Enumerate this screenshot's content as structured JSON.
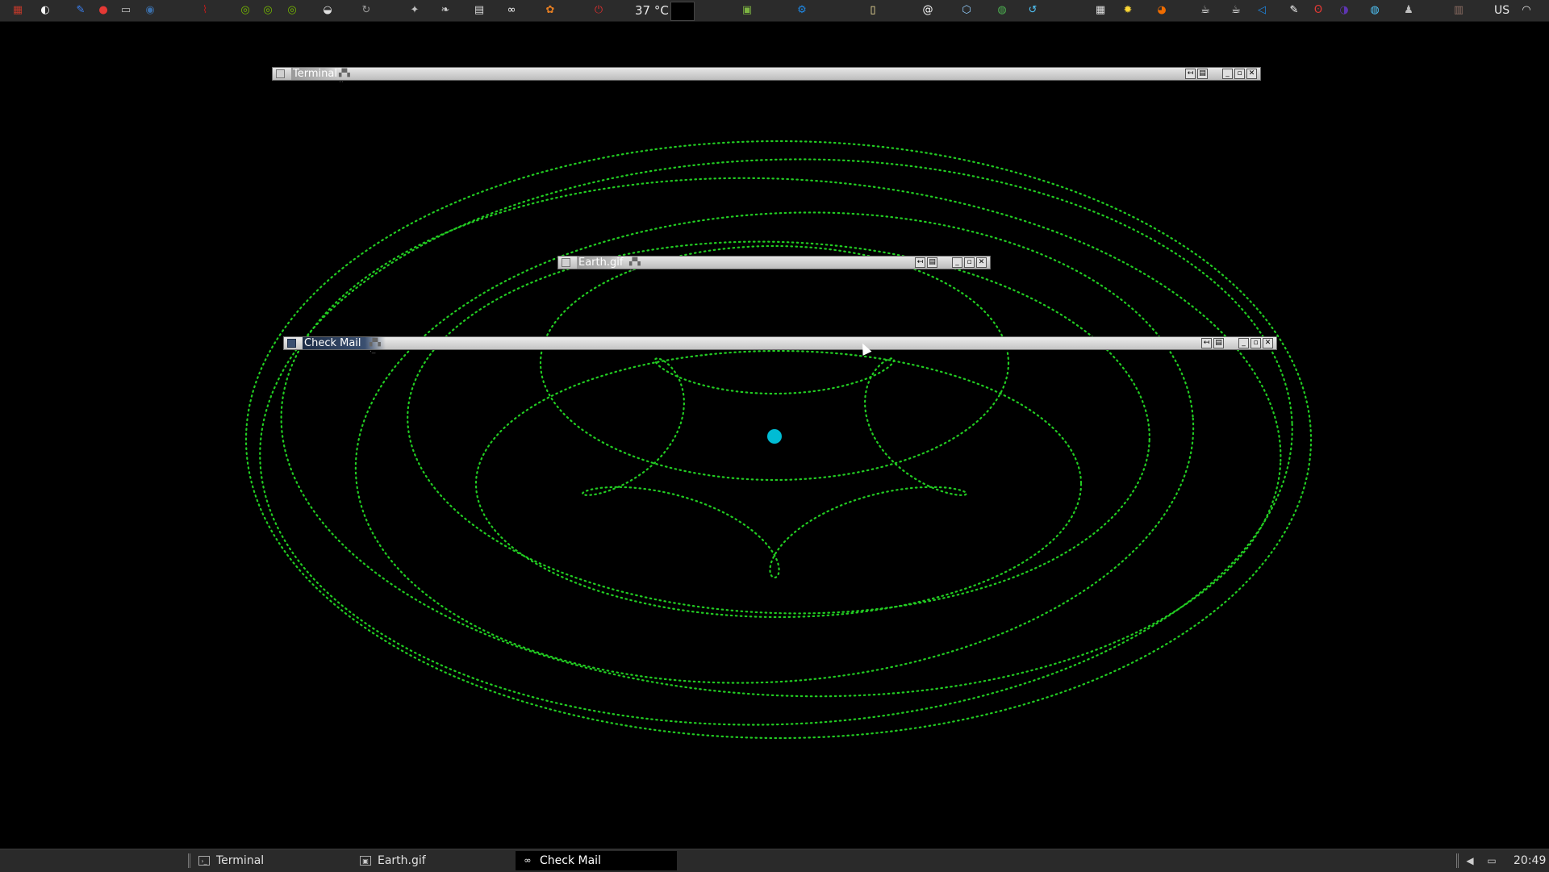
{
  "top_panel": {
    "temperature": "37 °C",
    "keyboard_layout": "US",
    "icons": [
      {
        "name": "app-grid-icon",
        "color": "#c0392b",
        "glyph": "▦"
      },
      {
        "name": "browser-icon",
        "color": "#f5f5f5",
        "glyph": "◐"
      },
      {
        "name": "notes-icon",
        "color": "#3b82f6",
        "glyph": "✎"
      },
      {
        "name": "apple-icon",
        "color": "#e53935",
        "glyph": "●"
      },
      {
        "name": "window-icon",
        "color": "#bdbdbd",
        "glyph": "▭"
      },
      {
        "name": "globe-icon",
        "color": "#3b6ea8",
        "glyph": "◉"
      },
      {
        "name": "chart-icon",
        "color": "#b71c1c",
        "glyph": "⌇"
      },
      {
        "name": "eye-icon-1",
        "color": "#76b900",
        "glyph": "◎"
      },
      {
        "name": "eye-icon-2",
        "color": "#76b900",
        "glyph": "◎"
      },
      {
        "name": "eye-icon-3",
        "color": "#76b900",
        "glyph": "◎"
      },
      {
        "name": "disk-icon",
        "color": "#e0e0e0",
        "glyph": "◒"
      },
      {
        "name": "reload-icon",
        "color": "#999999",
        "glyph": "↻"
      },
      {
        "name": "wrench-icon",
        "color": "#bfbfbf",
        "glyph": "✦"
      },
      {
        "name": "leaf-icon",
        "color": "#cccccc",
        "glyph": "❧"
      },
      {
        "name": "doc-icon",
        "color": "#d9d9d9",
        "glyph": "▤"
      },
      {
        "name": "glasses-icon",
        "color": "#ffffff",
        "glyph": "∞"
      },
      {
        "name": "flower-icon",
        "color": "#e67e22",
        "glyph": "✿"
      },
      {
        "name": "power-icon",
        "color": "#d32f2f",
        "glyph": "⏻"
      }
    ],
    "icons_right": [
      {
        "name": "screen-icon",
        "color": "#7cb342",
        "glyph": "▣"
      },
      {
        "name": "gear-icon",
        "color": "#1e88e5",
        "glyph": "⚙"
      },
      {
        "name": "note-icon",
        "color": "#f9e79f",
        "glyph": "▯"
      },
      {
        "name": "at-icon",
        "color": "#ffffff",
        "glyph": "@"
      },
      {
        "name": "cube-icon",
        "color": "#90caf9",
        "glyph": "⬡"
      },
      {
        "name": "chrome-icon",
        "color": "#4caf50",
        "glyph": "◍"
      },
      {
        "name": "sync-icon",
        "color": "#4fc3f7",
        "glyph": "↺"
      },
      {
        "name": "doc2-icon",
        "color": "#e0e0e0",
        "glyph": "▦"
      },
      {
        "name": "sun-icon",
        "color": "#fdd835",
        "glyph": "✹"
      },
      {
        "name": "pie-icon",
        "color": "#ef6c00",
        "glyph": "◕"
      },
      {
        "name": "cup-icon-1",
        "color": "#ffffff",
        "glyph": "☕"
      },
      {
        "name": "cup-icon-2",
        "color": "#ffffff",
        "glyph": "☕"
      },
      {
        "name": "vscode-icon",
        "color": "#1e88e5",
        "glyph": "◁"
      },
      {
        "name": "paper-icon",
        "color": "#ffffff",
        "glyph": "✎"
      },
      {
        "name": "ribbon-icon",
        "color": "#e53935",
        "glyph": "ʘ"
      },
      {
        "name": "moon-icon",
        "color": "#5e35b1",
        "glyph": "◑"
      },
      {
        "name": "earth-icon",
        "color": "#4fc3f7",
        "glyph": "◍"
      },
      {
        "name": "person-icon",
        "color": "#bdbdbd",
        "glyph": "♟"
      },
      {
        "name": "books-icon",
        "color": "#8d6e63",
        "glyph": "▥"
      },
      {
        "name": "wifi-icon",
        "color": "#e0e0e0",
        "glyph": "◠"
      }
    ]
  },
  "windows": {
    "terminal": {
      "title": "Terminal"
    },
    "earth": {
      "title": "Earth.gif"
    },
    "check_mail": {
      "title": "Check Mail"
    }
  },
  "taskbar": {
    "tasks": [
      {
        "label": "Terminal"
      },
      {
        "label": "Earth.gif"
      },
      {
        "label": "Check Mail"
      }
    ],
    "clock": "20:49"
  },
  "colors": {
    "orbit": "#22cc22",
    "center_dot": "#00bcd4",
    "panel": "#2b2b2b"
  }
}
